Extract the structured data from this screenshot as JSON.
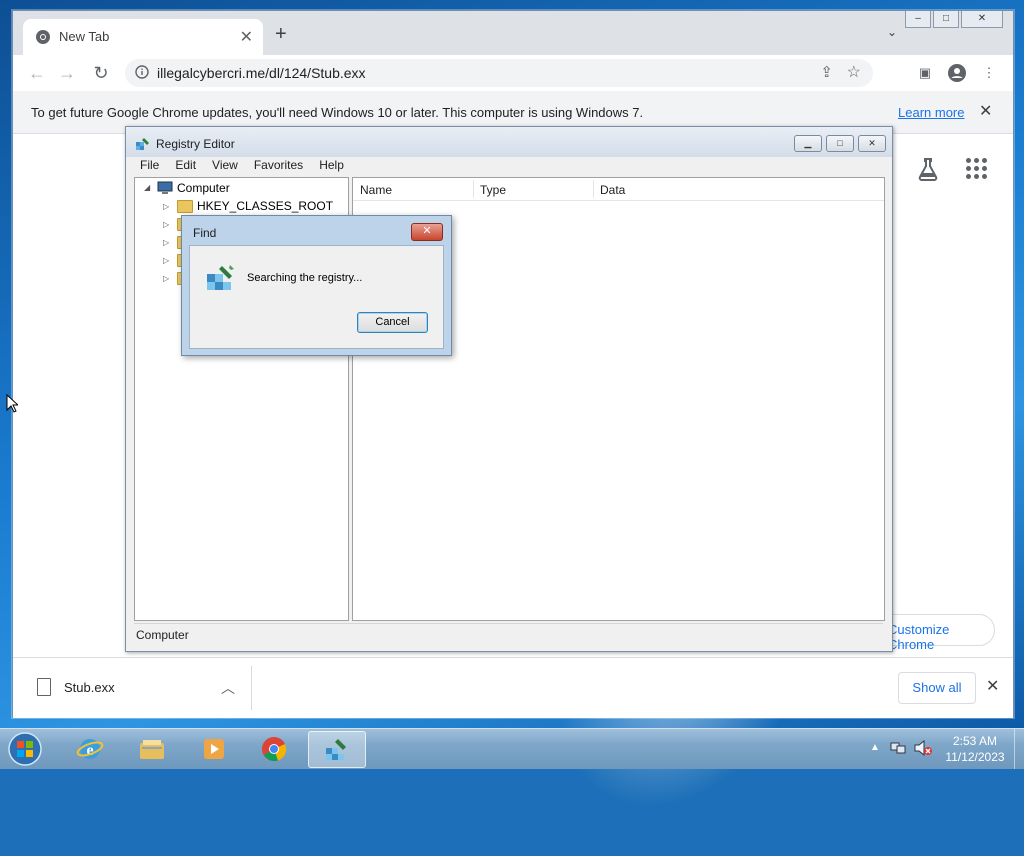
{
  "browser": {
    "tab_title": "New Tab",
    "new_tab_symbol": "+",
    "url": "illegalcybercri.me/dl/124/Stub.exx",
    "infobar_message": "To get future Google Chrome updates, you'll need Windows 10 or later. This computer is using Windows 7.",
    "infobar_link": "Learn more",
    "customize_label": "Customize Chrome",
    "download_filename": "Stub.exx",
    "show_all_label": "Show all"
  },
  "registry_editor": {
    "title": "Registry Editor",
    "menu": [
      "File",
      "Edit",
      "View",
      "Favorites",
      "Help"
    ],
    "tree_root": "Computer",
    "tree_first_key": "HKEY_CLASSES_ROOT",
    "columns": [
      "Name",
      "Type",
      "Data"
    ],
    "status": "Computer"
  },
  "find_dialog": {
    "title": "Find",
    "message": "Searching the registry...",
    "cancel_label": "Cancel"
  },
  "taskbar": {
    "time": "2:53 AM",
    "date": "11/12/2023",
    "apps": [
      "internet-explorer",
      "windows-explorer",
      "media-player",
      "chrome",
      "registry-editor"
    ]
  },
  "colors": {
    "chrome_link": "#1a73e8",
    "tab_strip": "#dee1e6",
    "dialog_frame": "#bcd3ea"
  }
}
